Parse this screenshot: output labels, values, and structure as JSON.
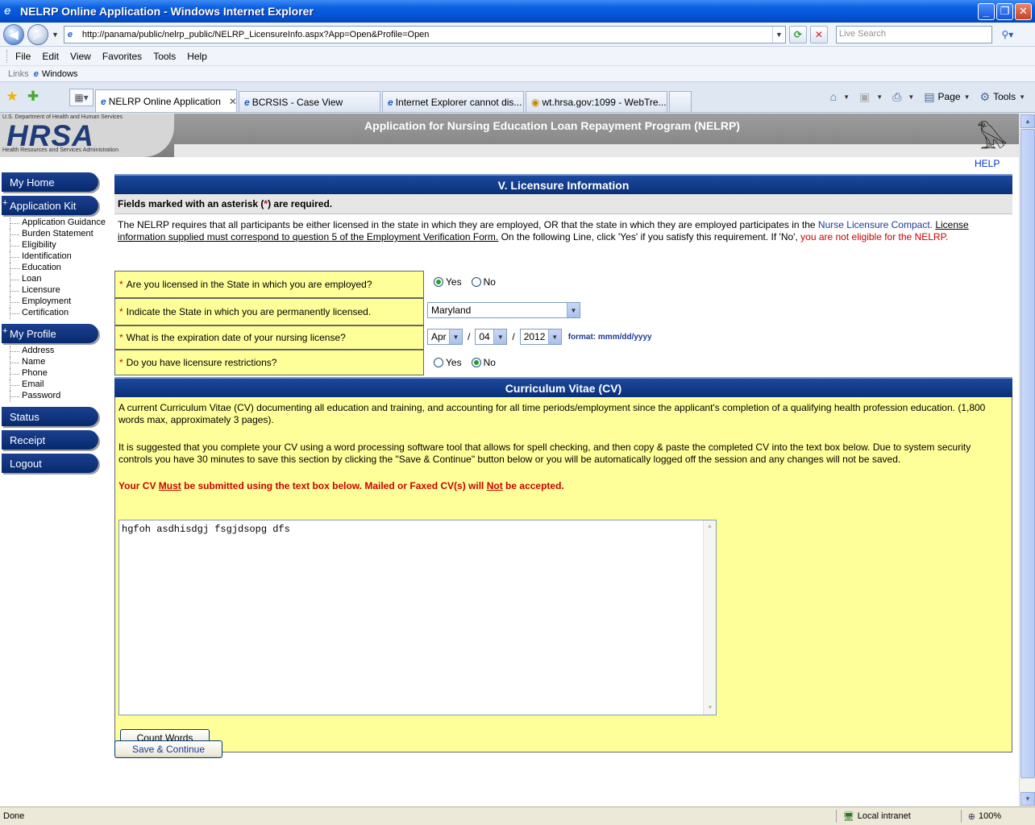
{
  "window": {
    "title": "NELRP Online Application - Windows Internet Explorer"
  },
  "navbar": {
    "url": "http://panama/public/nelrp_public/NELRP_LicensureInfo.aspx?App=Open&Profile=Open",
    "search_placeholder": "Live Search"
  },
  "menu": [
    "File",
    "Edit",
    "View",
    "Favorites",
    "Tools",
    "Help"
  ],
  "links": {
    "label": "Links",
    "item": "Windows"
  },
  "tabs": [
    {
      "label": "NELRP Online Application",
      "active": true
    },
    {
      "label": "BCRSIS - Case View",
      "active": false
    },
    {
      "label": "Internet Explorer cannot dis...",
      "active": false
    },
    {
      "label": "wt.hrsa.gov:1099 - WebTre...",
      "active": false
    }
  ],
  "commands": {
    "page": "Page",
    "tools": "Tools"
  },
  "banner": {
    "dept": "U.S. Department of Health and Human Services",
    "logo": "HRSA",
    "sub": "Health Resources and Services Administration",
    "title": "Application for Nursing Education Loan Repayment Program (NELRP)",
    "help": "HELP"
  },
  "leftnav": {
    "my_home": "My Home",
    "application_kit": "Application Kit",
    "app_items": [
      "Application Guidance",
      "Burden Statement",
      "Eligibility",
      "Identification",
      "Education",
      "Loan",
      "Licensure",
      "Employment",
      "Certification"
    ],
    "my_profile": "My Profile",
    "profile_items": [
      "Address",
      "Name",
      "Phone",
      "Email",
      "Password"
    ],
    "status": "Status",
    "receipt": "Receipt",
    "logout": "Logout"
  },
  "licensure": {
    "header": "V. Licensure Information",
    "required_pre": "Fields marked with an asterisk (",
    "required_star": "*",
    "required_post": ") are required.",
    "intro_1": "The NELRP requires that all participants be either licensed in the state in which they are employed, OR that the state in which they are employed participates in the ",
    "intro_link": "Nurse Licensure Compact.",
    "intro_2": "License information supplied must correspond to question 5 of the Employment Verification Form.",
    "intro_3": " On the following Line, click 'Yes' if you satisfy this requirement. If 'No', ",
    "intro_red": "you are not eligible for the NELRP.",
    "q1": "Are you licensed in the State in which you are employed?",
    "q1_answer": "Yes",
    "q2": "Indicate the State in which you are permanently licensed.",
    "q2_value": "Maryland",
    "q3": "What is the expiration date of your nursing license?",
    "q3_month": "Apr",
    "q3_day": "04",
    "q3_year": "2012",
    "q3_format": "format: mmm/dd/yyyy",
    "q4": "Do you have licensure restrictions?",
    "q4_answer": "No",
    "yes": "Yes",
    "no": "No",
    "star": "*"
  },
  "cv": {
    "header": "Curriculum Vitae (CV)",
    "p1": "A current Curriculum Vitae (CV) documenting all education and training, and accounting for all time periods/employment since the applicant's completion of a qualifying health profession education. (1,800 words max, approximately 3 pages).",
    "p2": "It is suggested that you complete your CV using a word processing software tool that allows for spell checking, and then copy & paste the completed CV into the text box below. Due to system security controls you have 30 minutes to save this section by clicking the \"Save & Continue\" button below or you will be automatically logged off the session and any changes will not be saved.",
    "warn_1": "Your CV ",
    "warn_must": "Must",
    "warn_2": " be submitted using the text box below. Mailed or Faxed CV(s) will ",
    "warn_not": "Not",
    "warn_3": " be accepted.",
    "text": "hgfoh asdhisdgj fsgjdsopg dfs",
    "count_button": "Count Words"
  },
  "save_button": "Save & Continue",
  "status": {
    "text": "Done",
    "zone": "Local intranet",
    "zoom": "100%"
  }
}
